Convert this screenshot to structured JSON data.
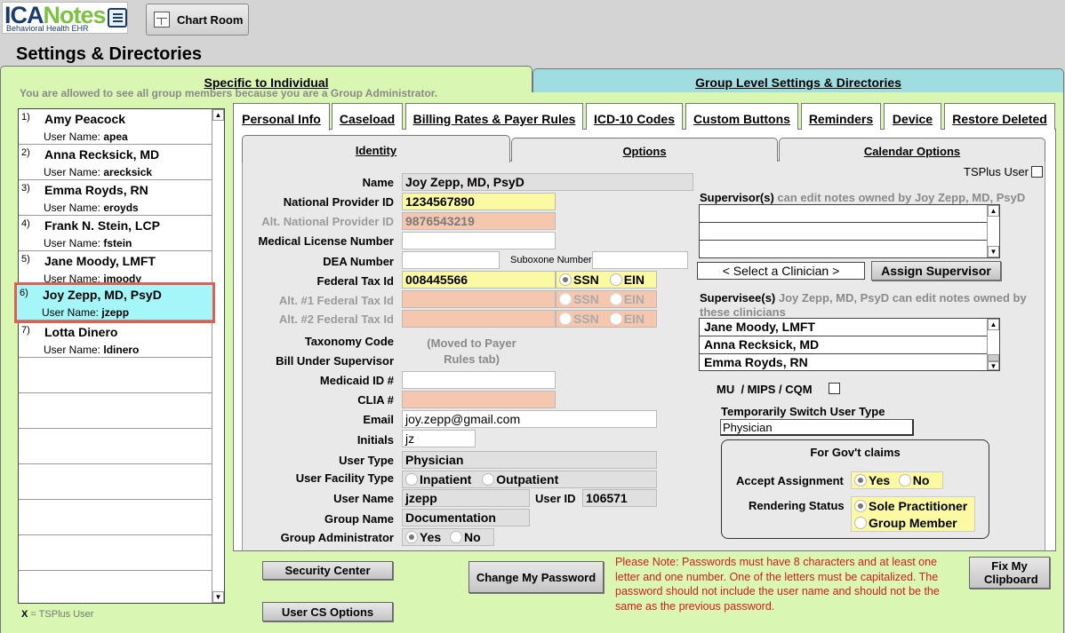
{
  "logo": {
    "brand_a": "ICA",
    "brand_b": "Notes",
    "sub": "Behavioral Health EHR"
  },
  "header": {
    "chart_room": "Chart Room",
    "title": "Settings & Directories"
  },
  "top_tabs": {
    "individual": "Specific to Individual",
    "group": "Group Level Settings & Directories"
  },
  "admin_note": "You are allowed to see all group members because you are a Group Administrator.",
  "users": [
    {
      "num": "1)",
      "name": "Amy Peacock",
      "username": "apea"
    },
    {
      "num": "2)",
      "name": "Anna Recksick, MD",
      "username": "arecksick"
    },
    {
      "num": "3)",
      "name": "Emma Royds, RN",
      "username": "eroyds"
    },
    {
      "num": "4)",
      "name": "Frank N. Stein, LCP",
      "username": "fstein"
    },
    {
      "num": "5)",
      "name": "Jane Moody, LMFT",
      "username": "jmoody"
    },
    {
      "num": "6)",
      "name": "Joy Zepp, MD, PsyD",
      "username": "jzepp"
    },
    {
      "num": "7)",
      "name": "Lotta Dinero",
      "username": "ldinero"
    }
  ],
  "username_label": "User Name: ",
  "legend": {
    "x": "X",
    "text": " = TSPlus User"
  },
  "inner_tabs": [
    "Personal Info",
    "Caseload",
    "Billing Rates & Payer Rules",
    "ICD-10 Codes",
    "Custom Buttons",
    "Reminders",
    "Device",
    "Restore Deleted"
  ],
  "identity_tabs": [
    "Identity",
    "Options",
    "Calendar Options"
  ],
  "labels": {
    "name": "Name",
    "npi": "National Provider ID",
    "alt_npi": "Alt. National Provider ID",
    "license": "Medical License Number",
    "dea": "DEA Number",
    "suboxone": "Suboxone Number",
    "tax": "Federal Tax Id",
    "alt1": "Alt. #1 Federal Tax Id",
    "alt2": "Alt. #2 Federal Tax Id",
    "taxonomy": "Taxonomy Code",
    "bill_under": "Bill Under Supervisor",
    "moved": "(Moved to Payer Rules tab)",
    "medicaid": "Medicaid ID #",
    "clia": "CLIA #",
    "email": "Email",
    "initials": "Initials",
    "user_type": "User Type",
    "facility": "User Facility Type",
    "user_name": "User Name",
    "user_id": "User ID",
    "group_name": "Group Name",
    "group_admin": "Group Administrator"
  },
  "values": {
    "name": "Joy Zepp, MD, PsyD",
    "npi": "1234567890",
    "alt_npi": "9876543219",
    "tax": "008445566",
    "email": "joy.zepp@gmail.com",
    "initials": "jz",
    "user_type": "Physician",
    "user_name": "jzepp",
    "user_id": "106571",
    "group_name": "Documentation"
  },
  "radios": {
    "ssn": "SSN",
    "ein": "EIN",
    "inpatient": "Inpatient",
    "outpatient": "Outpatient",
    "yes": "Yes",
    "no": "No"
  },
  "tsplus_user": "TSPlus User",
  "supervisors": {
    "title": "Supervisor(s)",
    "note": " can edit notes owned by Joy Zepp, MD, PsyD",
    "select": "< Select a Clinician >",
    "assign": "Assign Supervisor"
  },
  "supervisees": {
    "title": "Supervisee(s)",
    "note": " Joy Zepp, MD, PsyD can edit notes owned by these clinicians",
    "items": [
      "Jane Moody, LMFT",
      "Anna Recksick, MD",
      "Emma Royds, RN"
    ]
  },
  "mu": "MU  / MIPS / CQM",
  "switch_type": {
    "label": "Temporarily Switch User Type",
    "value": "Physician"
  },
  "govt": {
    "title": "For Gov't claims",
    "accept": "Accept Assignment",
    "rendering": "Rendering Status",
    "sole": "Sole Practitioner",
    "member": "Group Member"
  },
  "buttons": {
    "security": "Security Center",
    "cs": "User CS Options",
    "change_pw": "Change My Password",
    "fix": "Fix My Clipboard"
  },
  "pw_note": "Please Note: Passwords must have 8 characters and at least one letter and one number. One of the letters must be capitalized. The password should not include the user name and should not be the same as the previous password."
}
